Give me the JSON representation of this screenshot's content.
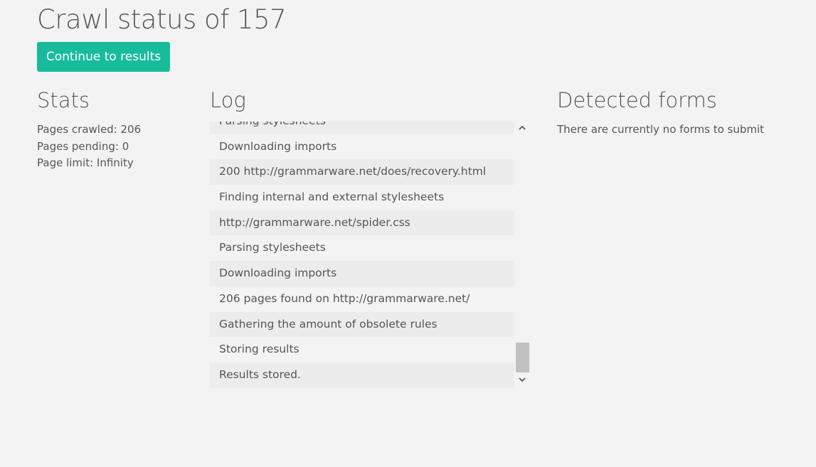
{
  "header": {
    "title": "Crawl status of 157",
    "continue_label": "Continue to results"
  },
  "stats": {
    "heading": "Stats",
    "lines": [
      "Pages crawled: 206",
      "Pages pending: 0",
      "Page limit: Infinity"
    ]
  },
  "log": {
    "heading": "Log",
    "entries": [
      "Parsing stylesheets",
      "Downloading imports",
      "200 http://grammarware.net/does/recovery.html",
      "Finding internal and external stylesheets",
      "http://grammarware.net/spider.css",
      "Parsing stylesheets",
      "Downloading imports",
      "206 pages found on http://grammarware.net/",
      "Gathering the amount of obsolete rules",
      "Storing results",
      "Results stored."
    ]
  },
  "forms": {
    "heading": "Detected forms",
    "empty_message": "There are currently no forms to submit"
  },
  "icons": {
    "scroll_up": "chevron-up-icon",
    "scroll_down": "chevron-down-icon"
  },
  "colors": {
    "accent": "#18bc9c",
    "background": "#f3f3f3",
    "row_stripe": "#ececec",
    "text": "#555555"
  }
}
